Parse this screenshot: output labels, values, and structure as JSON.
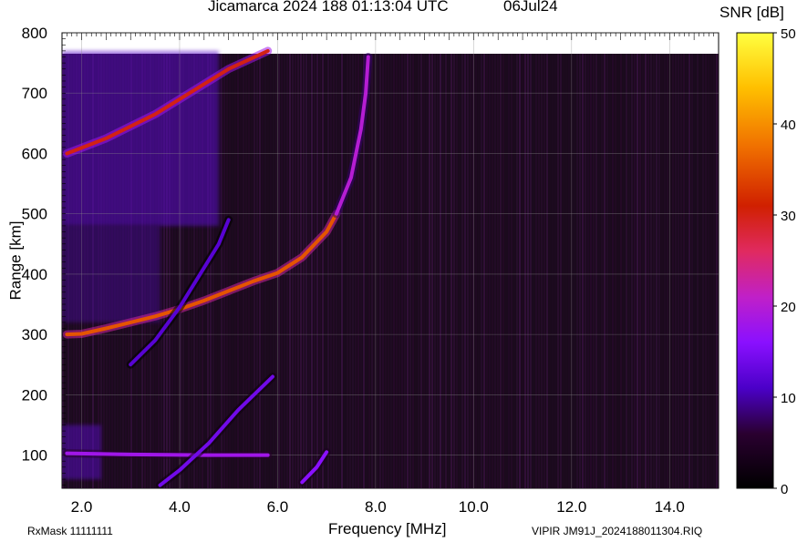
{
  "header": {
    "title": "Jicamarca 2024 188 01:13:04 UTC",
    "date": "06Jul24"
  },
  "footer": {
    "rxmask": "RxMask 11111111",
    "filename": "VIPIR  JM91J_2024188011304.RIQ"
  },
  "colorbar": {
    "title": "SNR [dB]",
    "ticks": [
      "0",
      "10",
      "20",
      "30",
      "40",
      "50"
    ]
  },
  "chart_data": {
    "type": "heatmap",
    "title": "Jicamarca 2024 188 01:13:04 UTC",
    "xlabel": "Frequency [MHz]",
    "ylabel": "Range [km]",
    "xlim": [
      1.6,
      15.0
    ],
    "ylim": [
      45,
      800
    ],
    "x_ticks": [
      "2.0",
      "4.0",
      "6.0",
      "8.0",
      "10.0",
      "12.0",
      "14.0"
    ],
    "y_ticks": [
      "100",
      "200",
      "300",
      "400",
      "500",
      "600",
      "700",
      "800"
    ],
    "colorbar_range": [
      0,
      50
    ],
    "colorbar_label": "SNR [dB]",
    "grid": true,
    "traces": [
      {
        "points": [
          [
            1.7,
            300
          ],
          [
            2.0,
            301
          ],
          [
            2.5,
            310
          ],
          [
            3.0,
            320
          ],
          [
            3.5,
            330
          ],
          [
            4.0,
            342
          ],
          [
            4.5,
            356
          ],
          [
            5.0,
            372
          ],
          [
            5.5,
            388
          ],
          [
            6.0,
            402
          ],
          [
            6.5,
            428
          ],
          [
            7.0,
            470
          ],
          [
            7.2,
            500
          ]
        ],
        "snr": 35
      },
      {
        "points": [
          [
            7.2,
            500
          ],
          [
            7.5,
            560
          ],
          [
            7.7,
            640
          ],
          [
            7.8,
            700
          ],
          [
            7.85,
            760
          ]
        ],
        "snr": 20
      },
      {
        "points": [
          [
            1.7,
            600
          ],
          [
            2.5,
            625
          ],
          [
            3.5,
            665
          ],
          [
            4.5,
            715
          ],
          [
            5.0,
            740
          ],
          [
            5.8,
            770
          ]
        ],
        "snr": 30
      },
      {
        "points": [
          [
            1.7,
            103
          ],
          [
            3.0,
            101
          ],
          [
            4.5,
            100
          ],
          [
            5.8,
            100
          ]
        ],
        "snr": 18
      },
      {
        "points": [
          [
            3.6,
            50
          ],
          [
            4.0,
            75
          ],
          [
            4.6,
            120
          ],
          [
            5.2,
            175
          ],
          [
            5.9,
            230
          ]
        ],
        "snr": 14
      },
      {
        "points": [
          [
            3.0,
            250
          ],
          [
            3.5,
            290
          ],
          [
            4.0,
            345
          ],
          [
            4.8,
            450
          ],
          [
            5.0,
            490
          ]
        ],
        "snr": 12
      },
      {
        "points": [
          [
            6.5,
            55
          ],
          [
            6.8,
            80
          ],
          [
            7.0,
            105
          ]
        ],
        "snr": 16
      }
    ]
  }
}
